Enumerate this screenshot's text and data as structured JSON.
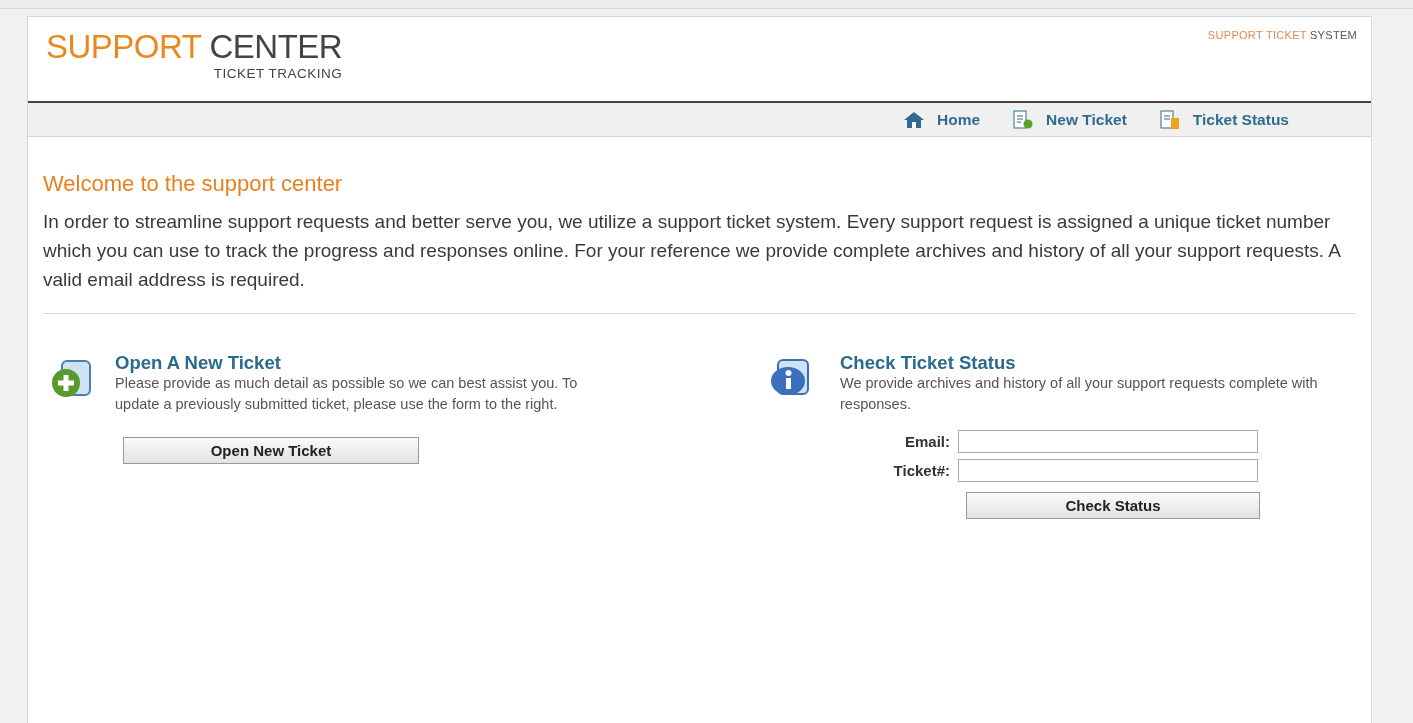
{
  "header": {
    "brand": {
      "primary": "SUPPORT",
      "secondary": "CENTER",
      "tagline": "TICKET TRACKING"
    },
    "system_label": {
      "highlight": "SUPPORT TICKET",
      "rest": "SYSTEM"
    }
  },
  "nav": [
    {
      "kind": "home",
      "label": "Home"
    },
    {
      "kind": "new",
      "label": "New Ticket"
    },
    {
      "kind": "status",
      "label": "Ticket Status"
    }
  ],
  "welcome": {
    "title": "Welcome to the support center",
    "text": "In order to streamline support requests and better serve you, we utilize a support ticket system. Every support request is assigned a unique ticket number which you can use to track the progress and responses online. For your reference we provide complete archives and history of all your support requests. A valid email address is required."
  },
  "open_ticket": {
    "title": "Open A New Ticket",
    "text": "Please provide as much detail as possible so we can best assist you. To update a previously submitted ticket, please use the form to the right.",
    "button": "Open New Ticket"
  },
  "check_status": {
    "title": "Check Ticket Status",
    "text": "We provide archives and history of all your support requests complete with responses.",
    "fields": [
      {
        "label": "Email:"
      },
      {
        "label": "Ticket#:"
      }
    ],
    "button": "Check Status"
  }
}
